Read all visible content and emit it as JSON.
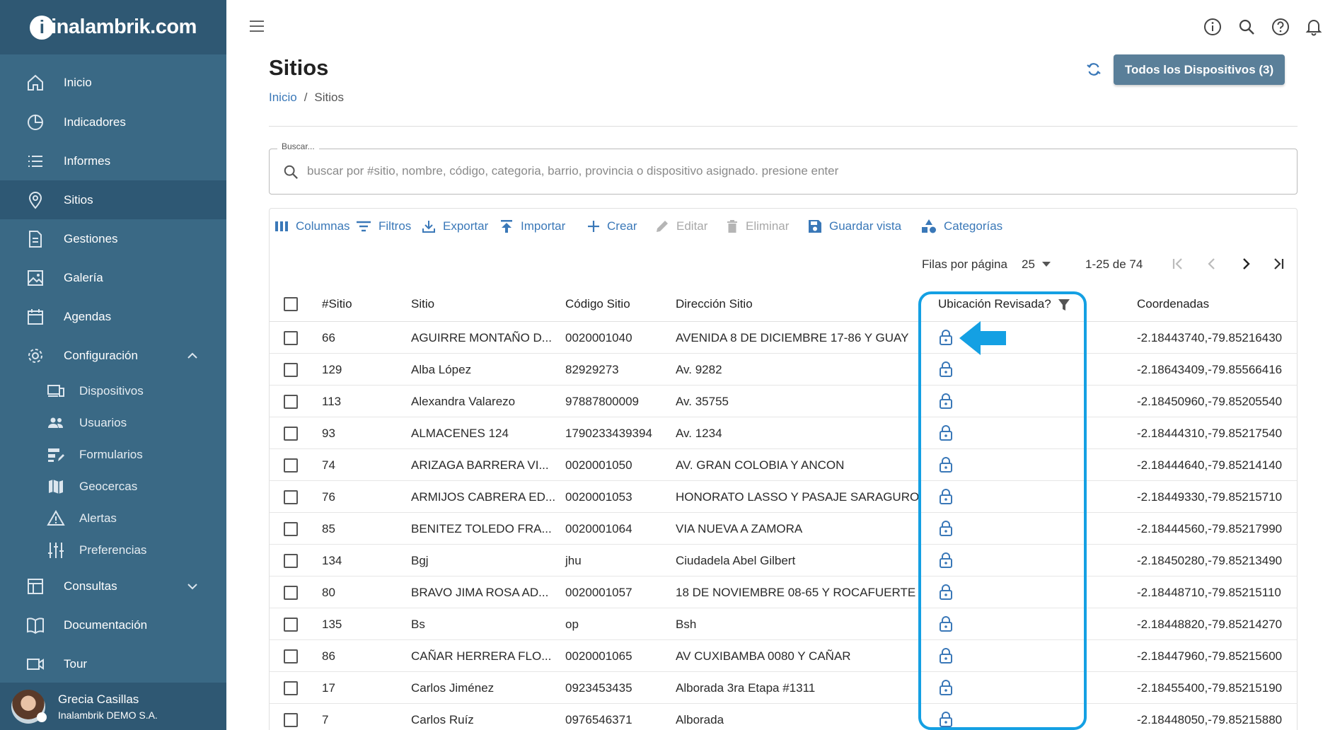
{
  "app": {
    "logo": "inalambrik.com"
  },
  "sidebar": {
    "items": [
      {
        "label": "Inicio",
        "icon": "home-icon"
      },
      {
        "label": "Indicadores",
        "icon": "chart-pie-icon"
      },
      {
        "label": "Informes",
        "icon": "list-icon"
      },
      {
        "label": "Sitios",
        "icon": "map-pin-icon",
        "active": true
      },
      {
        "label": "Gestiones",
        "icon": "document-icon"
      },
      {
        "label": "Galería",
        "icon": "image-icon"
      },
      {
        "label": "Agendas",
        "icon": "calendar-icon"
      },
      {
        "label": "Configuración",
        "icon": "gear-icon"
      },
      {
        "label": "Consultas",
        "icon": "table-icon"
      },
      {
        "label": "Documentación",
        "icon": "book-icon"
      },
      {
        "label": "Tour",
        "icon": "video-icon"
      }
    ],
    "sub_items": [
      {
        "label": "Dispositivos",
        "icon": "devices-icon"
      },
      {
        "label": "Usuarios",
        "icon": "users-icon"
      },
      {
        "label": "Formularios",
        "icon": "forms-icon"
      },
      {
        "label": "Geocercas",
        "icon": "map-icon"
      },
      {
        "label": "Alertas",
        "icon": "warning-icon"
      },
      {
        "label": "Preferencias",
        "icon": "sliders-icon"
      }
    ],
    "user": {
      "name": "Grecia Casillas",
      "org": "Inalambrik DEMO S.A."
    }
  },
  "header": {
    "title": "Sitios",
    "breadcrumb": {
      "home": "Inicio",
      "separator": "/",
      "current": "Sitios"
    },
    "devices_button": "Todos los Dispositivos (3)"
  },
  "search": {
    "label": "Buscar...",
    "placeholder": "buscar por #sitio, nombre, código, categoria, barrio, provincia o dispositivo asignado. presione enter",
    "value": ""
  },
  "toolbar": {
    "columns": "Columnas",
    "filters": "Filtros",
    "export": "Exportar",
    "import": "Importar",
    "create": "Crear",
    "edit": "Editar",
    "delete": "Eliminar",
    "save_view": "Guardar vista",
    "categories": "Categorías"
  },
  "pagination": {
    "rows_label": "Filas por página",
    "rows_value": "25",
    "range": "1-25 de 74"
  },
  "table": {
    "columns": [
      "#Sitio",
      "Sitio",
      "Código Sitio",
      "Dirección Sitio",
      "Ubicación Revisada?",
      "Coordenadas"
    ],
    "rows": [
      {
        "id": "66",
        "sitio": "AGUIRRE MONTAÑO D...",
        "codigo": "0020001040",
        "direccion": "AVENIDA 8 DE DICIEMBRE 17-86 Y GUAY",
        "coords": "-2.18443740,-79.85216430"
      },
      {
        "id": "129",
        "sitio": "Alba López",
        "codigo": "82929273",
        "direccion": "Av. 9282",
        "coords": "-2.18643409,-79.85566416"
      },
      {
        "id": "113",
        "sitio": "Alexandra Valarezo",
        "codigo": "97887800009",
        "direccion": "Av. 35755",
        "coords": "-2.18450960,-79.85205540"
      },
      {
        "id": "93",
        "sitio": "ALMACENES 124",
        "codigo": "1790233439394",
        "direccion": "Av. 1234",
        "coords": "-2.18444310,-79.85217540"
      },
      {
        "id": "74",
        "sitio": "ARIZAGA BARRERA VI...",
        "codigo": "0020001050",
        "direccion": "AV. GRAN COLOBIA Y ANCON",
        "coords": "-2.18444640,-79.85214140"
      },
      {
        "id": "76",
        "sitio": "ARMIJOS CABRERA ED...",
        "codigo": "0020001053",
        "direccion": "HONORATO LASSO Y PASAJE SARAGURO",
        "coords": "-2.18449330,-79.85215710"
      },
      {
        "id": "85",
        "sitio": "BENITEZ TOLEDO FRA...",
        "codigo": "0020001064",
        "direccion": "VIA NUEVA A ZAMORA",
        "coords": "-2.18444560,-79.85217990"
      },
      {
        "id": "134",
        "sitio": "Bgj",
        "codigo": "jhu",
        "direccion": "Ciudadela Abel Gilbert",
        "coords": "-2.18450280,-79.85213490"
      },
      {
        "id": "80",
        "sitio": "BRAVO JIMA ROSA AD...",
        "codigo": "0020001057",
        "direccion": "18 DE NOVIEMBRE 08-65 Y ROCAFUERTE",
        "coords": "-2.18448710,-79.85215110"
      },
      {
        "id": "135",
        "sitio": "Bs",
        "codigo": "op",
        "direccion": "Bsh",
        "coords": "-2.18448820,-79.85214270"
      },
      {
        "id": "86",
        "sitio": "CAÑAR HERRERA FLO...",
        "codigo": "0020001065",
        "direccion": "AV CUXIBAMBA 0080 Y CAÑAR",
        "coords": "-2.18447960,-79.85215600"
      },
      {
        "id": "17",
        "sitio": "Carlos Jiménez",
        "codigo": "0923453435",
        "direccion": "Alborada 3ra Etapa #1311",
        "coords": "-2.18455400,-79.85215190"
      },
      {
        "id": "7",
        "sitio": "Carlos Ruíz",
        "codigo": "0976546371",
        "direccion": "Alborada",
        "coords": "-2.18448050,-79.85215880"
      }
    ]
  },
  "colors": {
    "sidebar": "#3a6985",
    "accent": "#3a78b8",
    "highlight": "#14a0e3"
  }
}
